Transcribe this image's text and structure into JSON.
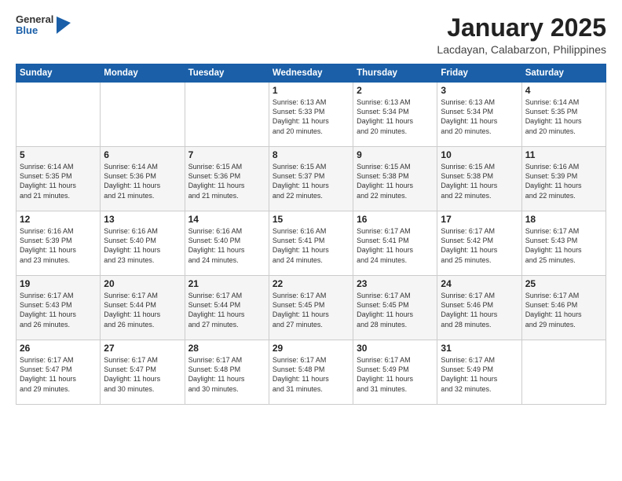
{
  "logo": {
    "general": "General",
    "blue": "Blue"
  },
  "header": {
    "month": "January 2025",
    "location": "Lacdayan, Calabarzon, Philippines"
  },
  "weekdays": [
    "Sunday",
    "Monday",
    "Tuesday",
    "Wednesday",
    "Thursday",
    "Friday",
    "Saturday"
  ],
  "weeks": [
    [
      {
        "day": "",
        "info": ""
      },
      {
        "day": "",
        "info": ""
      },
      {
        "day": "",
        "info": ""
      },
      {
        "day": "1",
        "info": "Sunrise: 6:13 AM\nSunset: 5:33 PM\nDaylight: 11 hours\nand 20 minutes."
      },
      {
        "day": "2",
        "info": "Sunrise: 6:13 AM\nSunset: 5:34 PM\nDaylight: 11 hours\nand 20 minutes."
      },
      {
        "day": "3",
        "info": "Sunrise: 6:13 AM\nSunset: 5:34 PM\nDaylight: 11 hours\nand 20 minutes."
      },
      {
        "day": "4",
        "info": "Sunrise: 6:14 AM\nSunset: 5:35 PM\nDaylight: 11 hours\nand 20 minutes."
      }
    ],
    [
      {
        "day": "5",
        "info": "Sunrise: 6:14 AM\nSunset: 5:35 PM\nDaylight: 11 hours\nand 21 minutes."
      },
      {
        "day": "6",
        "info": "Sunrise: 6:14 AM\nSunset: 5:36 PM\nDaylight: 11 hours\nand 21 minutes."
      },
      {
        "day": "7",
        "info": "Sunrise: 6:15 AM\nSunset: 5:36 PM\nDaylight: 11 hours\nand 21 minutes."
      },
      {
        "day": "8",
        "info": "Sunrise: 6:15 AM\nSunset: 5:37 PM\nDaylight: 11 hours\nand 22 minutes."
      },
      {
        "day": "9",
        "info": "Sunrise: 6:15 AM\nSunset: 5:38 PM\nDaylight: 11 hours\nand 22 minutes."
      },
      {
        "day": "10",
        "info": "Sunrise: 6:15 AM\nSunset: 5:38 PM\nDaylight: 11 hours\nand 22 minutes."
      },
      {
        "day": "11",
        "info": "Sunrise: 6:16 AM\nSunset: 5:39 PM\nDaylight: 11 hours\nand 22 minutes."
      }
    ],
    [
      {
        "day": "12",
        "info": "Sunrise: 6:16 AM\nSunset: 5:39 PM\nDaylight: 11 hours\nand 23 minutes."
      },
      {
        "day": "13",
        "info": "Sunrise: 6:16 AM\nSunset: 5:40 PM\nDaylight: 11 hours\nand 23 minutes."
      },
      {
        "day": "14",
        "info": "Sunrise: 6:16 AM\nSunset: 5:40 PM\nDaylight: 11 hours\nand 24 minutes."
      },
      {
        "day": "15",
        "info": "Sunrise: 6:16 AM\nSunset: 5:41 PM\nDaylight: 11 hours\nand 24 minutes."
      },
      {
        "day": "16",
        "info": "Sunrise: 6:17 AM\nSunset: 5:41 PM\nDaylight: 11 hours\nand 24 minutes."
      },
      {
        "day": "17",
        "info": "Sunrise: 6:17 AM\nSunset: 5:42 PM\nDaylight: 11 hours\nand 25 minutes."
      },
      {
        "day": "18",
        "info": "Sunrise: 6:17 AM\nSunset: 5:43 PM\nDaylight: 11 hours\nand 25 minutes."
      }
    ],
    [
      {
        "day": "19",
        "info": "Sunrise: 6:17 AM\nSunset: 5:43 PM\nDaylight: 11 hours\nand 26 minutes."
      },
      {
        "day": "20",
        "info": "Sunrise: 6:17 AM\nSunset: 5:44 PM\nDaylight: 11 hours\nand 26 minutes."
      },
      {
        "day": "21",
        "info": "Sunrise: 6:17 AM\nSunset: 5:44 PM\nDaylight: 11 hours\nand 27 minutes."
      },
      {
        "day": "22",
        "info": "Sunrise: 6:17 AM\nSunset: 5:45 PM\nDaylight: 11 hours\nand 27 minutes."
      },
      {
        "day": "23",
        "info": "Sunrise: 6:17 AM\nSunset: 5:45 PM\nDaylight: 11 hours\nand 28 minutes."
      },
      {
        "day": "24",
        "info": "Sunrise: 6:17 AM\nSunset: 5:46 PM\nDaylight: 11 hours\nand 28 minutes."
      },
      {
        "day": "25",
        "info": "Sunrise: 6:17 AM\nSunset: 5:46 PM\nDaylight: 11 hours\nand 29 minutes."
      }
    ],
    [
      {
        "day": "26",
        "info": "Sunrise: 6:17 AM\nSunset: 5:47 PM\nDaylight: 11 hours\nand 29 minutes."
      },
      {
        "day": "27",
        "info": "Sunrise: 6:17 AM\nSunset: 5:47 PM\nDaylight: 11 hours\nand 30 minutes."
      },
      {
        "day": "28",
        "info": "Sunrise: 6:17 AM\nSunset: 5:48 PM\nDaylight: 11 hours\nand 30 minutes."
      },
      {
        "day": "29",
        "info": "Sunrise: 6:17 AM\nSunset: 5:48 PM\nDaylight: 11 hours\nand 31 minutes."
      },
      {
        "day": "30",
        "info": "Sunrise: 6:17 AM\nSunset: 5:49 PM\nDaylight: 11 hours\nand 31 minutes."
      },
      {
        "day": "31",
        "info": "Sunrise: 6:17 AM\nSunset: 5:49 PM\nDaylight: 11 hours\nand 32 minutes."
      },
      {
        "day": "",
        "info": ""
      }
    ]
  ]
}
